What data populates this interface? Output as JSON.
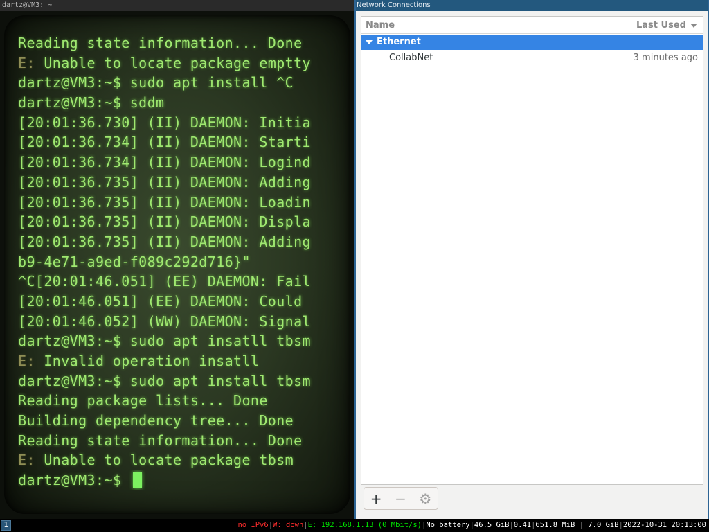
{
  "terminal": {
    "title": "dartz@VM3: ~",
    "lines": [
      {
        "prefix": "",
        "text": "Reading state information... Done"
      },
      {
        "prefix": "E:",
        "text": " Unable to locate package emptty"
      },
      {
        "prefix": "",
        "text": "dartz@VM3:~$ sudo apt install ^C"
      },
      {
        "prefix": "",
        "text": "dartz@VM3:~$ sddm"
      },
      {
        "prefix": "",
        "text": "[20:01:36.730] (II) DAEMON: Initia"
      },
      {
        "prefix": "",
        "text": "[20:01:36.734] (II) DAEMON: Starti"
      },
      {
        "prefix": "",
        "text": "[20:01:36.734] (II) DAEMON: Logind"
      },
      {
        "prefix": "",
        "text": "[20:01:36.735] (II) DAEMON: Adding"
      },
      {
        "prefix": "",
        "text": "[20:01:36.735] (II) DAEMON: Loadin"
      },
      {
        "prefix": "",
        "text": "[20:01:36.735] (II) DAEMON: Displa"
      },
      {
        "prefix": "",
        "text": "[20:01:36.735] (II) DAEMON: Adding"
      },
      {
        "prefix": "",
        "text": "b9-4e71-a9ed-f089c292d716}\""
      },
      {
        "prefix": "",
        "text": "^C[20:01:46.051] (EE) DAEMON: Fail"
      },
      {
        "prefix": "",
        "text": "[20:01:46.051] (EE) DAEMON: Could"
      },
      {
        "prefix": "",
        "text": "[20:01:46.052] (WW) DAEMON: Signal"
      },
      {
        "prefix": "",
        "text": "dartz@VM3:~$ sudo apt insatll tbsm"
      },
      {
        "prefix": "E:",
        "text": " Invalid operation insatll"
      },
      {
        "prefix": "",
        "text": "dartz@VM3:~$ sudo apt install tbsm"
      },
      {
        "prefix": "",
        "text": "Reading package lists... Done"
      },
      {
        "prefix": "",
        "text": "Building dependency tree... Done"
      },
      {
        "prefix": "",
        "text": "Reading state information... Done"
      },
      {
        "prefix": "E:",
        "text": " Unable to locate package tbsm"
      }
    ],
    "prompt": "dartz@VM3:~$ "
  },
  "network": {
    "title": "Network Connections",
    "columns": {
      "name": "Name",
      "last_used": "Last Used"
    },
    "group": "Ethernet",
    "connection": {
      "name": "CollabNet",
      "last_used": "3 minutes ago"
    },
    "toolbar": {
      "add": "+",
      "remove": "−",
      "settings": "⚙"
    }
  },
  "statusbar": {
    "workspace": "1",
    "ipv6": "no IPv6",
    "wireless": "W: down",
    "ethernet": "E: 192.168.1.13 (0 Mbit/s)",
    "battery": "No battery",
    "disk": "46.5 GiB",
    "load": "0.41",
    "memory": "651.8 MiB",
    "memory_total": "7.0 GiB",
    "datetime": "2022-10-31 20:13:00"
  }
}
